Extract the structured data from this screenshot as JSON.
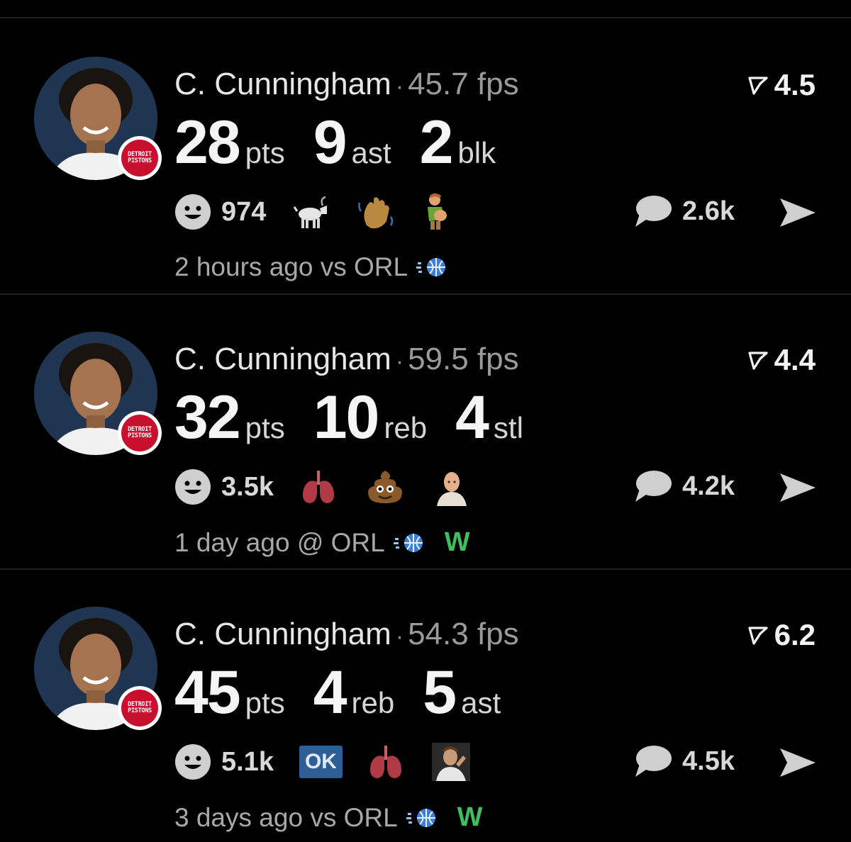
{
  "cards": [
    {
      "player": "C. Cunningham",
      "fps": "45.7 fps",
      "rating": "4.5",
      "stats": [
        {
          "value": "28",
          "label": "pts"
        },
        {
          "value": "9",
          "label": "ast"
        },
        {
          "value": "2",
          "label": "blk"
        }
      ],
      "reaction_count": "974",
      "reactions": [
        "goat-emoji",
        "waving-hand-emoji",
        "pregnant-person-emoji"
      ],
      "comments": "2.6k",
      "time": "2 hours ago",
      "opponent": "vs ORL",
      "result": ""
    },
    {
      "player": "C. Cunningham",
      "fps": "59.5 fps",
      "rating": "4.4",
      "stats": [
        {
          "value": "32",
          "label": "pts"
        },
        {
          "value": "10",
          "label": "reb"
        },
        {
          "value": "4",
          "label": "stl"
        }
      ],
      "reaction_count": "3.5k",
      "reactions": [
        "lungs-emoji",
        "pile-of-poo-emoji",
        "bald-person-sticker"
      ],
      "comments": "4.2k",
      "time": "1 day ago",
      "opponent": "@ ORL",
      "result": "W"
    },
    {
      "player": "C. Cunningham",
      "fps": "54.3 fps",
      "rating": "6.2",
      "stats": [
        {
          "value": "45",
          "label": "pts"
        },
        {
          "value": "4",
          "label": "reb"
        },
        {
          "value": "5",
          "label": "ast"
        }
      ],
      "reaction_count": "5.1k",
      "ok_badge": "OK",
      "reactions": [
        "lungs-emoji",
        "facepalm-player-sticker"
      ],
      "comments": "4.5k",
      "time": "3 days ago",
      "opponent": "vs ORL",
      "result": "W"
    }
  ],
  "team_logo_text": [
    "DETROIT",
    "PISTONS"
  ],
  "colors": {
    "background": "#000000",
    "win": "#3fbf5e",
    "team_red": "#c8102e",
    "ok_badge": "#2e5e96"
  }
}
